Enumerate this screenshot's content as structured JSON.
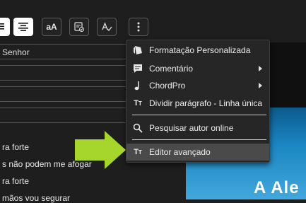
{
  "toolbar": {
    "buttons": [
      {
        "name": "align-justify-icon"
      },
      {
        "name": "align-center-icon"
      },
      {
        "label": "aA",
        "name": "font-case-button"
      },
      {
        "name": "document-check-icon"
      },
      {
        "name": "spellcheck-icon"
      },
      {
        "name": "more-options-icon"
      }
    ]
  },
  "editor": {
    "rows": [
      "Senhor",
      "",
      "",
      ""
    ],
    "lyrics": [
      "ra forte",
      "s não podem me afogar",
      "ra forte",
      "mãos vou segurar"
    ]
  },
  "preview": {
    "text": "A Ale"
  },
  "menu": {
    "items": [
      {
        "label": "Formatação Personalizada",
        "icon": "tag-icon"
      },
      {
        "label": "Comentário",
        "icon": "comment-icon",
        "submenu": true
      },
      {
        "label": "ChordPro",
        "icon": "music-note-icon",
        "submenu": true
      },
      {
        "label": "Dividir parágrafo - Linha única",
        "icon": "text-size-icon"
      },
      {
        "label": "Pesquisar autor online",
        "icon": "search-icon"
      },
      {
        "label": "Editor avançado",
        "icon": "text-size-icon",
        "highlighted": true
      }
    ]
  },
  "colors": {
    "accent_arrow": "#a6d62b",
    "menu_bg": "#262626",
    "highlight": "#4a4a4a"
  }
}
